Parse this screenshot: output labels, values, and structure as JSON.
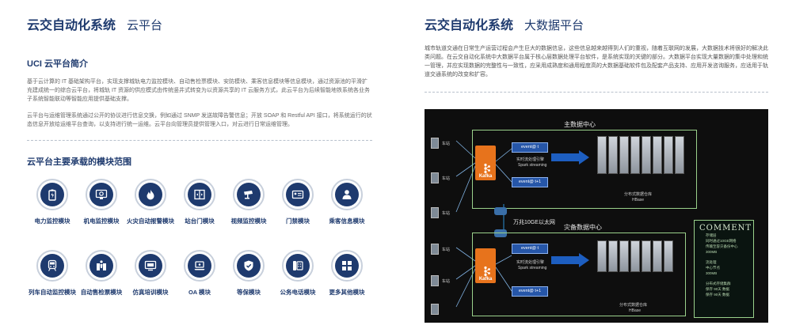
{
  "left": {
    "header_main": "云交自动化系统",
    "header_sub": "云平台",
    "intro_title": "UCI 云平台简介",
    "intro_para1": "基于云计算的 IT 基础架构平台，实现支撑城轨电力监控模块、自动售检票模块、安防模块、乘客信息模块等信息模块，通过资源池的平滑扩充建成统一的综合云平台，将城轨 IT 资源的供应模式由传统竖井式转变为以资源共享的 IT 云服务方式，此云平台为后续智能地铁系统各业务子系统智能联动等智能应用提供基础支撑。",
    "intro_para2": "云平台与运维管理系统通过公开的协议进行信息交换，例如通过 SNMP 发送故障告警信息；开放 SOAP 和 Restful API 接口，将系统运行的状态信息开放给运维平台查询，以支持进行统一运维。云平台向管理员提供管理入口，对云进行日常运维管理。",
    "modules_title": "云平台主要承载的模块范围",
    "modules": [
      {
        "label": "电力监控模块",
        "icon": "battery-icon"
      },
      {
        "label": "机电监控模块",
        "icon": "monitor-gear-icon"
      },
      {
        "label": "火灾自动报警模块",
        "icon": "fire-icon"
      },
      {
        "label": "站台门模块",
        "icon": "platform-door-icon"
      },
      {
        "label": "视频监控模块",
        "icon": "camera-icon"
      },
      {
        "label": "门禁模块",
        "icon": "id-card-icon"
      },
      {
        "label": "乘客信息模块",
        "icon": "passenger-icon"
      },
      {
        "label": "列车自动监控模块",
        "icon": "train-icon"
      },
      {
        "label": "自动售检票模块",
        "icon": "ticket-gate-icon"
      },
      {
        "label": "仿真培训模块",
        "icon": "simulation-screen-icon"
      },
      {
        "label": "OA 模块",
        "icon": "oa-laptop-icon"
      },
      {
        "label": "等保模块",
        "icon": "shield-icon"
      },
      {
        "label": "公务电话模块",
        "icon": "telephone-icon"
      },
      {
        "label": "更多其他模块",
        "icon": "grid-icon"
      }
    ]
  },
  "right": {
    "header_main": "云交自动化系统",
    "header_sub": "大数据平台",
    "para": "城市轨道交通在日常生产运营过程会产生巨大的数据信息，这些信息越来越得到人们的重视，随着互联网的发展，大数据技术将很好的解决此类问题。在云交自动化系统中大数据平台属于核心层数据处理平台软件，是系统实现的关键的部分。大数据平台实现大量数据的集中处理和统一管理，并应实现数据的完整性与一致性，应采用成熟度和通用程度高的大数据基础软件包及配套产品支持、应用开发咨询服务，应适用于轨道交通系统的改变和扩容。"
  },
  "diagram": {
    "main_center": "主数据中心",
    "backup_center": "灾备数据中心",
    "network": "万兆10GE以太网",
    "kafka": "Kafka",
    "event_top": "event@ t",
    "event_bottom": "event@ t+1",
    "stream_cn": "实时流处理引擎",
    "stream_en": "Spark streaming",
    "store_cn": "分布式数据仓库",
    "store_en": "HBase",
    "station": "车站",
    "comment_title": "COMMENT",
    "comment_lines": [
      "存储层",
      "同时通过10GE网络",
      "传输至容灾备份中心",
      "300MB",
      "流处理",
      "中心节点",
      "300MB",
      "分布式存储集群",
      "保存 90天 数据",
      "保存 90天 数据"
    ]
  },
  "colors": {
    "primary": "#1e3a6e",
    "kafka": "#e7731c",
    "panel_border": "#9ad18b",
    "event": "#2656a8"
  }
}
